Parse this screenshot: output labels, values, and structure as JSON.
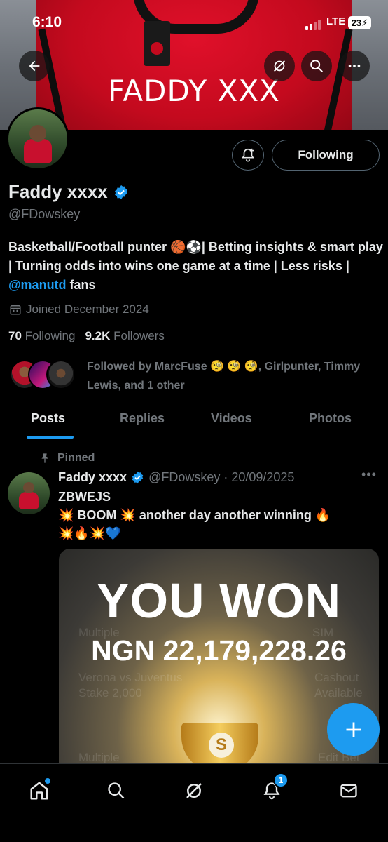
{
  "status_bar": {
    "time": "6:10",
    "network": "LTE",
    "battery": "23"
  },
  "banner": {
    "shirt_text": "FADDY XXX"
  },
  "profile": {
    "display_name": "Faddy xxxx",
    "handle": "@FDowskey",
    "follow_button": "Following",
    "bio_text": "Basketball/Football punter 🏀⚽| Betting insights & smart play | Turning odds into wins one game at a time | Less risks | ",
    "bio_mention": "@manutd",
    "bio_suffix": " fans",
    "joined": "Joined December 2024",
    "following_count": "70",
    "following_label": "Following",
    "followers_count": "9.2K",
    "followers_label": "Followers",
    "followed_by": "Followed by MarcFuse 🧐 🧐 🧐, Girlpunter, Timmy Lewis, and 1 other"
  },
  "tabs": [
    "Posts",
    "Replies",
    "Videos",
    "Photos"
  ],
  "post": {
    "pinned_label": "Pinned",
    "author": "Faddy xxxx",
    "meta": "@FDowskey · 20/09/2025",
    "line1": "ZBWEJS",
    "line2": "💥 BOOM 💥 another day another winning 🔥",
    "line3": "💥🔥💥💙",
    "media": {
      "headline": "YOU WON",
      "amount": "NGN 22,179,228.26",
      "bg_labels": [
        "Multiple",
        "SIM",
        "Verona vs Juventus",
        "Cashout",
        "Stake 2,000",
        "Available",
        "Multiple",
        "Edit Bet"
      ],
      "logo_letter": "S"
    }
  },
  "nav": {
    "notification_count": "1",
    "icons": [
      "home-icon",
      "search-icon",
      "grok-icon",
      "bell-icon",
      "mail-icon"
    ]
  },
  "colors": {
    "accent": "#1d9bf0",
    "muted": "#71767b",
    "text": "#e7e9ea",
    "background": "#000000"
  }
}
